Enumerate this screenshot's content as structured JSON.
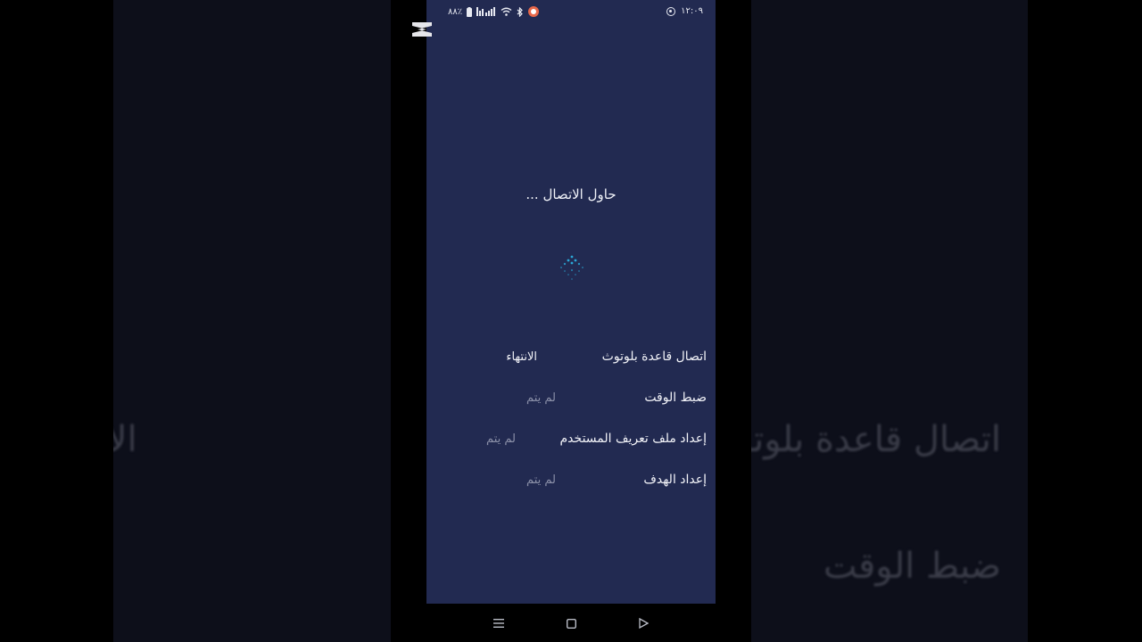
{
  "status_bar": {
    "battery": "٨٨٪",
    "time": "١٢:٠٩"
  },
  "title": "حاول الاتصال ...",
  "steps": [
    {
      "label": "اتصال قاعدة بلوتوث",
      "status": "الانتهاء",
      "state": "done"
    },
    {
      "label": "ضبط الوقت",
      "status": "لم يتم",
      "state": "pending"
    },
    {
      "label": "إعداد ملف تعريف المستخدم",
      "status": "لم يتم",
      "state": "pending"
    },
    {
      "label": "إعداد الهدف",
      "status": "لم يتم",
      "state": "pending"
    }
  ],
  "background_ghost": {
    "line1": "اتصال قاعدة بلوتوث",
    "line1_left": "الانتهاء",
    "line2": "ضبط الوقت"
  },
  "colors": {
    "screen_bg": "#222a51",
    "spinner": "#2aa7d6",
    "pending_text": "#8b90a8"
  },
  "icons": [
    "capcut-logo-icon",
    "battery-icon",
    "signal-icon",
    "wifi-icon",
    "bluetooth-icon",
    "screen-record-icon",
    "location-target-icon",
    "loading-spinner-icon",
    "menu-icon",
    "home-icon",
    "back-icon"
  ]
}
